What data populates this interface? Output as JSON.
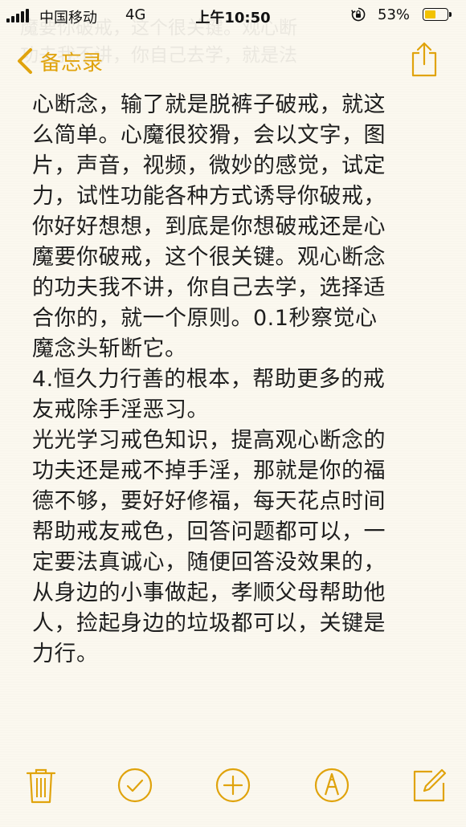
{
  "status_bar": {
    "carrier": "中国移动",
    "network": "4G",
    "time": "上午10:50",
    "battery_percent": "53%",
    "battery_level": 0.53,
    "icons": [
      "signal-icon",
      "orientation-lock-icon",
      "battery-icon"
    ]
  },
  "nav": {
    "back_label": "备忘录",
    "ghost_lines": [
      "魔要你破戒，这个很关键。观心断",
      "功夫我不讲，你自己去学，就是法"
    ],
    "accent_color": "#e0a30c"
  },
  "note": {
    "lines": [
      "心断念，输了就是脱裤子破戒，就这",
      "么简单。心魔很狡猾，会以文字，图",
      "片，声音，视频，微妙的感觉，试定",
      "力，试性功能各种方式诱导你破戒，",
      "你好好想想，到底是你想破戒还是心",
      "魔要你破戒，这个很关键。观心断念",
      "的功夫我不讲，你自己去学，选择适",
      "合你的，就一个原则。0.1秒察觉心",
      "魔念头斩断它。",
      "4.恒久力行善的根本，帮助更多的戒",
      "友戒除手淫恶习。",
      "光光学习戒色知识，提高观心断念的",
      "功夫还是戒不掉手淫，那就是你的福",
      "德不够，要好好修福，每天花点时间",
      "帮助戒友戒色，回答问题都可以，一",
      "定要法真诚心，随便回答没效果的，",
      "从身边的小事做起，孝顺父母帮助他",
      "人，捡起身边的垃圾都可以，关键是",
      "力行。"
    ]
  },
  "toolbar": {
    "icons": [
      "trash-icon",
      "checklist-icon",
      "add-icon",
      "sketch-icon",
      "compose-icon"
    ]
  }
}
